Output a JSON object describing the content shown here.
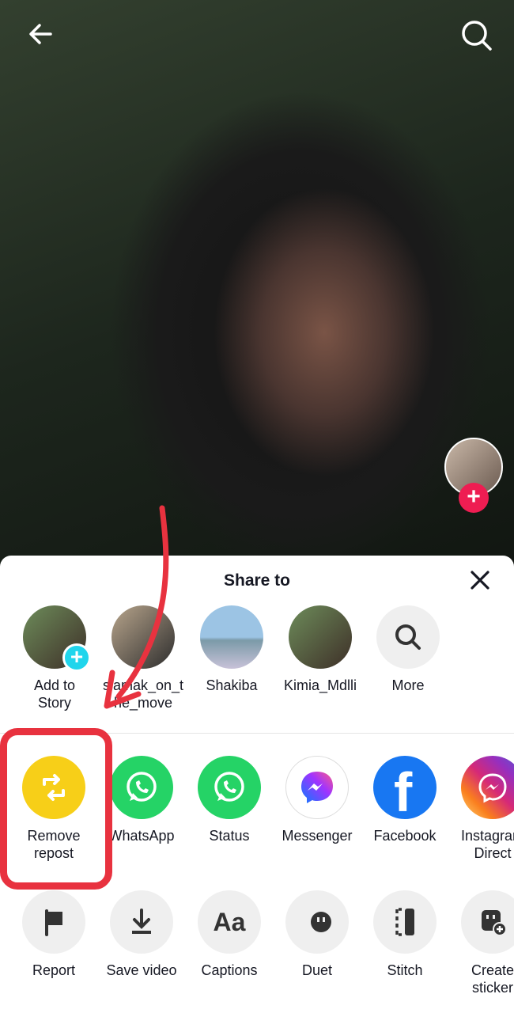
{
  "header": {
    "back_icon": "arrow-left-icon",
    "search_icon": "search-icon"
  },
  "side": {
    "follow_plus": "+"
  },
  "share": {
    "title": "Share to",
    "contacts": [
      {
        "label": "Add to Story",
        "colors": [
          "#6d8c5a",
          "#3e2f28"
        ]
      },
      {
        "label": "siamak_on_the_move",
        "colors": [
          "#b8a58c",
          "#2d2d2d"
        ]
      },
      {
        "label": "Shakiba",
        "colors": [
          "#9cc4e4",
          "#c8c2d8"
        ]
      },
      {
        "label": "Kimia_Mdlli",
        "colors": [
          "#6d8c5a",
          "#3e2f28"
        ]
      },
      {
        "label": "More"
      }
    ],
    "apps": [
      {
        "label": "Remove repost",
        "color": "#f7cf18"
      },
      {
        "label": "WhatsApp",
        "color": "#25d366"
      },
      {
        "label": "Status",
        "color": "#25d366"
      },
      {
        "label": "Messenger",
        "color": "#ffffff"
      },
      {
        "label": "Facebook",
        "color": "#1877f2"
      },
      {
        "label": "Instagram Direct",
        "color": "#d62976"
      }
    ],
    "actions": [
      {
        "label": "Report",
        "icon": "flag-icon"
      },
      {
        "label": "Save video",
        "icon": "download-icon"
      },
      {
        "label": "Captions",
        "icon": "captions-icon",
        "glyph": "Aa"
      },
      {
        "label": "Duet",
        "icon": "duet-icon"
      },
      {
        "label": "Stitch",
        "icon": "stitch-icon"
      },
      {
        "label": "Create sticker",
        "icon": "sticker-icon"
      }
    ]
  },
  "annotation": {
    "highlight_color": "#e8323f"
  }
}
